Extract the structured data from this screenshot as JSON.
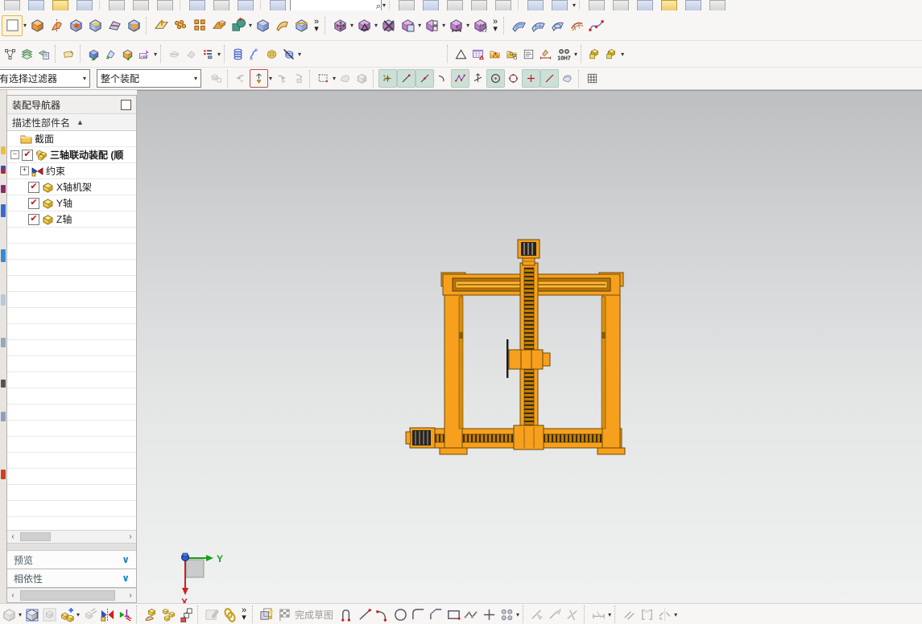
{
  "toolbars": {
    "selection_filter": "有选择过滤器",
    "assembly_scope": "整个装配",
    "fit_tolerance": "10H7",
    "finish_sketch_label": "完成草图",
    "command_finder_value": "",
    "row1_icons": [
      "sketch-new",
      "extrude",
      "revolve",
      "hole",
      "boss",
      "emboss",
      "shell",
      "datum-plane",
      "pattern-feature",
      "pattern-geometry",
      "mirror-feature",
      "unite-boolean",
      "block",
      "sheet",
      "chamfer",
      "move-component",
      "assembly-constraints",
      "delete-component",
      "copy-component",
      "component-pattern",
      "component-position",
      "arrange-component",
      "swept-surface",
      "mesh-surface",
      "bounded-plane",
      "curve-mesh",
      "studio-spline"
    ],
    "row2_icons": [
      "snap-handles",
      "layer-settings",
      "layer-visible",
      "note-tag",
      "measure-distance",
      "simple-interference",
      "examine-geometry",
      "edit-text",
      "section-a",
      "section-b",
      "edit-list",
      "coil-spring",
      "extension-spring",
      "washer-coil",
      "delete-spring",
      "triangle-tolerance",
      "table-annotation",
      "point-set-folder",
      "hole-set-folder",
      "notes-doc",
      "measure-brush",
      "fit-binoculars",
      "lock-cube-a",
      "lock-cube-b"
    ],
    "row3_icons": [
      "assembly-filter",
      "undo-filter",
      "select-highlight",
      "redo-filter",
      "grab-filter",
      "marquee-select",
      "shaded-face",
      "solid-face",
      "snap-point-cluster",
      "snap-end-point",
      "snap-mid-point",
      "snap-arc",
      "snap-spline-point",
      "snap-intersection",
      "snap-circle-center",
      "snap-quadrant",
      "snap-existing-point",
      "snap-point-on-line",
      "snap-face-point",
      "grid-snap"
    ],
    "bottom_icons": [
      "edit-cube",
      "stack-cubes",
      "box-cubes",
      "add-component",
      "move-cube",
      "assembly-constraint-bowtie",
      "axis-arrows",
      "hand-component",
      "pattern-components",
      "sequence-chain",
      "edit-pencil-cube",
      "chain-links",
      "wave-geometry-linker",
      "finish-sketch-flag",
      "profile-curve",
      "sketch-line",
      "sketch-arc",
      "sketch-circle",
      "sketch-fillet",
      "sketch-chamfer",
      "sketch-rectangle",
      "sketch-polyline",
      "sketch-point",
      "pattern-curve",
      "quick-trim",
      "quick-extend",
      "make-corner",
      "rapid-dimension",
      "parallel-constraint",
      "constraint-brackets",
      "mirror-curve"
    ]
  },
  "assembly_navigator": {
    "title": "装配导航器",
    "column_header": "描述性部件名",
    "tree": [
      {
        "label": "截面",
        "icon": "folder"
      },
      {
        "label": "三轴联动装配 (顺",
        "icon": "assembly",
        "checked": true,
        "expand": "minus"
      },
      {
        "label": "约束",
        "icon": "constraints",
        "expand": "plus"
      },
      {
        "label": "X轴机架",
        "icon": "part",
        "checked": true
      },
      {
        "label": "Y轴",
        "icon": "part",
        "checked": true
      },
      {
        "label": "Z轴",
        "icon": "part",
        "checked": true
      }
    ],
    "sections": [
      {
        "label": "预览"
      },
      {
        "label": "相依性"
      }
    ]
  },
  "viewport": {
    "axis_x_label": "X",
    "axis_y_label": "Y",
    "model": "three-axis linked gantry assembly",
    "model_color": "#F7A01E",
    "background_top": "#bdbfc1",
    "background_bottom": "#f1f2f2"
  },
  "colors": {
    "accent_orange": "#F7A01E",
    "check_red": "#D01010",
    "chevron_blue": "#1E88C7",
    "snap_toggle_bg": "#CDE0D8"
  }
}
